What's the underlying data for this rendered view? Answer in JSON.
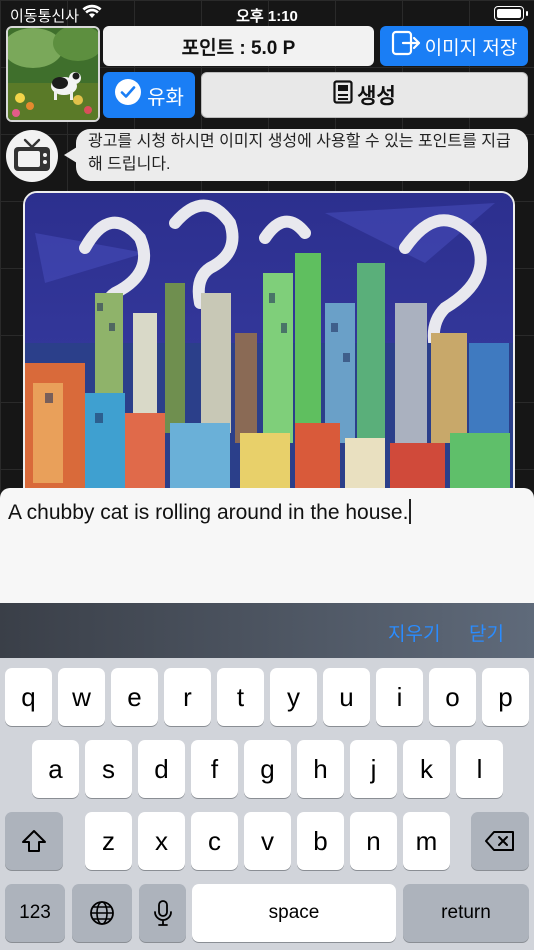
{
  "status_bar": {
    "carrier": "이동통신사",
    "time": "오후 1:10"
  },
  "header": {
    "points_label": "포인트 : 5.0 P",
    "save_image_label": "이미지 저장",
    "oil_painting_label": "유화",
    "generate_label": "생성"
  },
  "ad_notice": {
    "text": "광고를 시청 하시면 이미지 생성에 사용할 수 있는 포인트를 지급해 드립니다."
  },
  "prompt_editor": {
    "value": "A chubby cat is rolling around in the house."
  },
  "keyboard_toolbar": {
    "clear_label": "지우기",
    "close_label": "닫기"
  },
  "keyboard": {
    "row1": [
      "q",
      "w",
      "e",
      "r",
      "t",
      "y",
      "u",
      "i",
      "o",
      "p"
    ],
    "row2": [
      "a",
      "s",
      "d",
      "f",
      "g",
      "h",
      "j",
      "k",
      "l"
    ],
    "row3": [
      "z",
      "x",
      "c",
      "v",
      "b",
      "n",
      "m"
    ],
    "numbers_label": "123",
    "space_label": "space",
    "return_label": "return"
  },
  "colors": {
    "accent": "#1a7ef5",
    "toolbar_action": "#2a8cff"
  }
}
